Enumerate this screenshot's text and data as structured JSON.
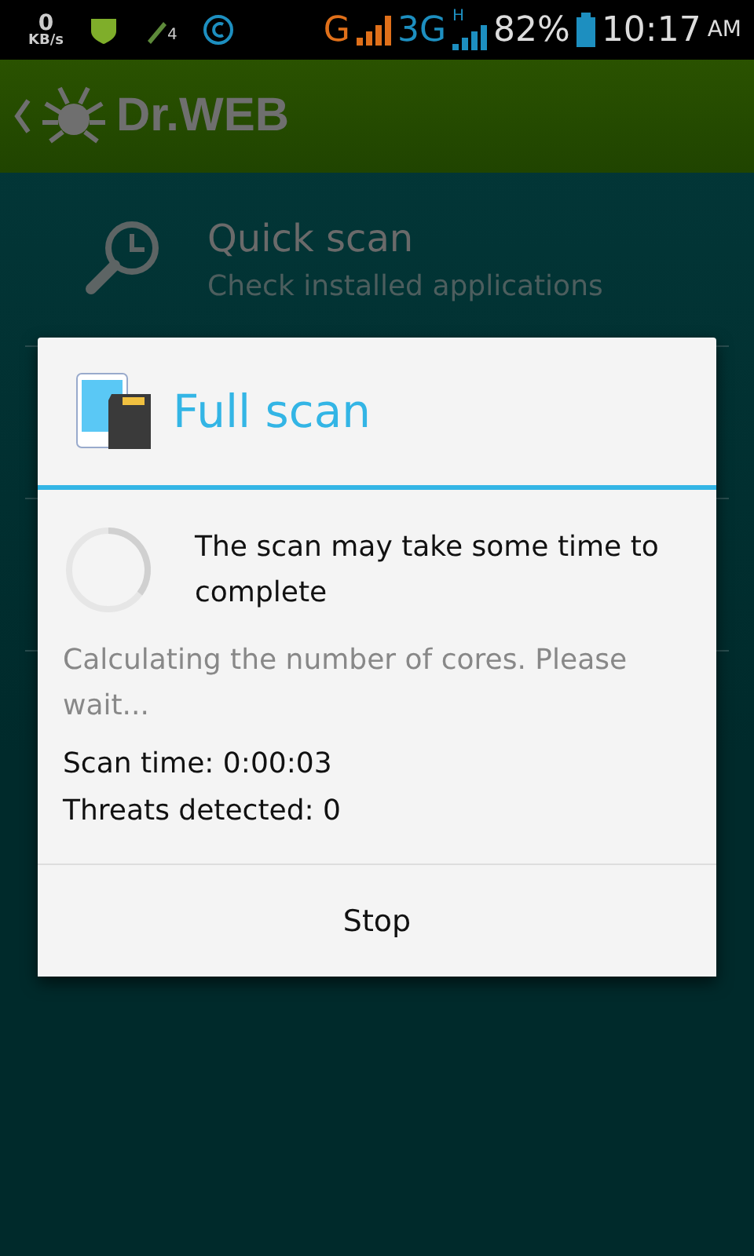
{
  "status_bar": {
    "speed_value": "0",
    "speed_unit": "KB/s",
    "sim_badge": "4",
    "network_1": "G",
    "network_2": "3G",
    "network_2_badge": "H",
    "battery": "82%",
    "time": "10:17",
    "meridiem": "AM"
  },
  "app_bar": {
    "title": "Dr.WEB"
  },
  "menu": [
    {
      "title": "Quick scan",
      "subtitle": "Check installed applications"
    }
  ],
  "dialog": {
    "title": "Full scan",
    "message": "The scan may take some time to complete",
    "status": "Calculating the number of cores. Please wait...",
    "scan_time": "Scan time: 0:00:03",
    "threats": "Threats detected: 0",
    "button": "Stop"
  }
}
